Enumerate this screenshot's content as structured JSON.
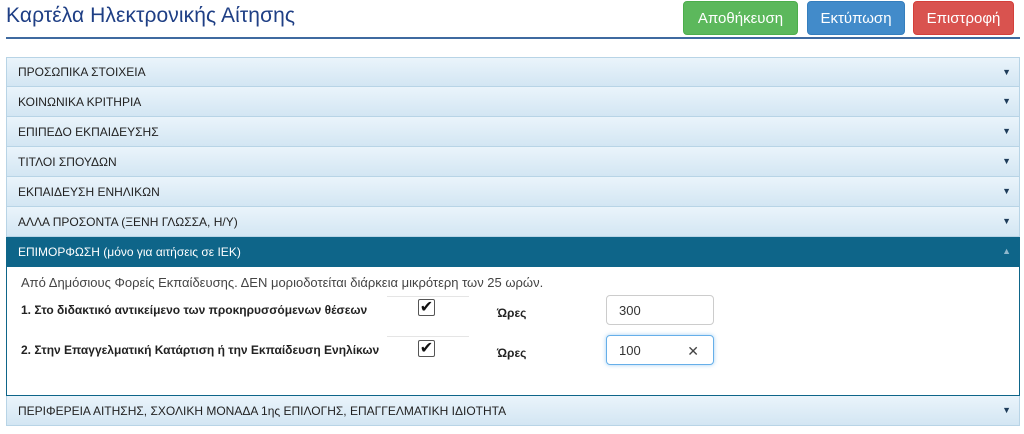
{
  "header": {
    "title": "Καρτέλα Ηλεκτρονικής Αίτησης",
    "buttons": {
      "save": "Αποθήκευση",
      "print": "Εκτύπωση",
      "back": "Επιστροφή"
    }
  },
  "accordion": {
    "sections": [
      {
        "label": "ΠΡΟΣΩΠΙΚΑ ΣΤΟΙΧΕΙΑ",
        "expanded": false
      },
      {
        "label": "ΚΟΙΝΩΝΙΚΑ ΚΡΙΤΗΡΙΑ",
        "expanded": false
      },
      {
        "label": "ΕΠΙΠΕΔΟ ΕΚΠΑΙΔΕΥΣΗΣ",
        "expanded": false
      },
      {
        "label": "ΤΙΤΛΟΙ ΣΠΟΥΔΩΝ",
        "expanded": false
      },
      {
        "label": "ΕΚΠΑΙΔΕΥΣΗ ΕΝΗΛΙΚΩΝ",
        "expanded": false
      },
      {
        "label": "ΑΛΛΑ ΠΡΟΣΟΝΤΑ (ΞΕΝΗ ΓΛΩΣΣΑ, Η/Υ)",
        "expanded": false
      },
      {
        "label": "ΕΠΙΜΟΡΦΩΣΗ (μόνο για αιτήσεις σε ΙΕΚ)",
        "expanded": true
      },
      {
        "label": "ΠΕΡΙΦΕΡΕΙΑ ΑΙΤΗΣΗΣ, ΣΧΟΛΙΚΗ ΜΟΝΑΔΑ 1ης ΕΠΙΛΟΓΗΣ, ΕΠΑΓΓΕΛΜΑΤΙΚΗ ΙΔΙΟΤΗΤΑ",
        "expanded": false
      }
    ],
    "arrow_collapsed": "▼",
    "arrow_expanded": "▲"
  },
  "training_panel": {
    "note": "Από Δημόσιους Φορείς Εκπαίδευσης. ΔΕΝ μοριοδοτείται διάρκεια μικρότερη των 25 ωρών.",
    "rows": [
      {
        "label": "1. Στο διδακτικό αντικείμενο των προκηρυσσόμενων θέσεων",
        "checked": true,
        "check_mark": "✔",
        "hours_label": "Ώρες",
        "hours_value": "300"
      },
      {
        "label": "2. Στην Επαγγελματική Κατάρτιση ή την Εκπαίδευση Ενηλίκων",
        "checked": true,
        "check_mark": "✔",
        "hours_label": "Ώρες",
        "hours_value": "100",
        "clear_glyph": "✕"
      }
    ]
  },
  "colors": {
    "title": "#1f3f85",
    "save": "#5cb85c",
    "print": "#428bca",
    "back": "#d9534f",
    "active_header": "#0e6589"
  }
}
